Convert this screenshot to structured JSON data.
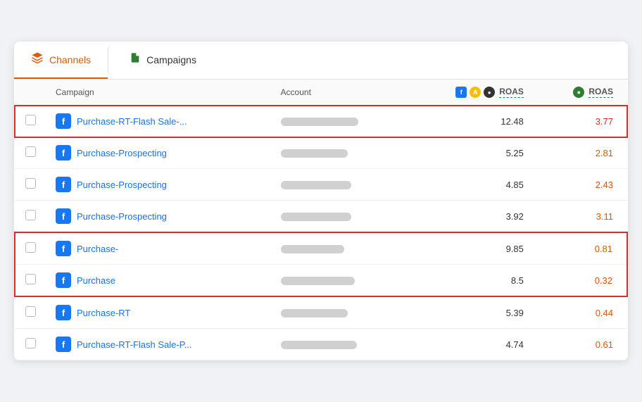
{
  "tabs": {
    "channels_label": "Channels",
    "campaigns_label": "Campaigns"
  },
  "table": {
    "col_campaign": "Campaign",
    "col_account": "Account",
    "col_roas1_label": "ROAS",
    "col_roas2_label": "ROAS",
    "rows": [
      {
        "id": 1,
        "campaign": "Purchase-RT-Flash Sale-...",
        "roas1": "12.48",
        "roas2": "3.77",
        "highlight": "single"
      },
      {
        "id": 2,
        "campaign": "Purchase-Prospecting",
        "roas1": "5.25",
        "roas2": "2.81",
        "highlight": "none"
      },
      {
        "id": 3,
        "campaign": "Purchase-Prospecting",
        "roas1": "4.85",
        "roas2": "2.43",
        "highlight": "none"
      },
      {
        "id": 4,
        "campaign": "Purchase-Prospecting",
        "roas1": "3.92",
        "roas2": "3.11",
        "highlight": "none"
      },
      {
        "id": 5,
        "campaign": "Purchase-",
        "roas1": "9.85",
        "roas2": "0.81",
        "highlight": "top"
      },
      {
        "id": 6,
        "campaign": "Purchase",
        "roas1": "8.5",
        "roas2": "0.32",
        "highlight": "bot"
      },
      {
        "id": 7,
        "campaign": "Purchase-RT",
        "roas1": "5.39",
        "roas2": "0.44",
        "highlight": "none"
      },
      {
        "id": 8,
        "campaign": "Purchase-RT-Flash Sale-P...",
        "roas1": "4.74",
        "roas2": "0.61",
        "highlight": "none"
      }
    ],
    "account_bar_widths": [
      110,
      95,
      100,
      100,
      90,
      105,
      95,
      108
    ]
  }
}
